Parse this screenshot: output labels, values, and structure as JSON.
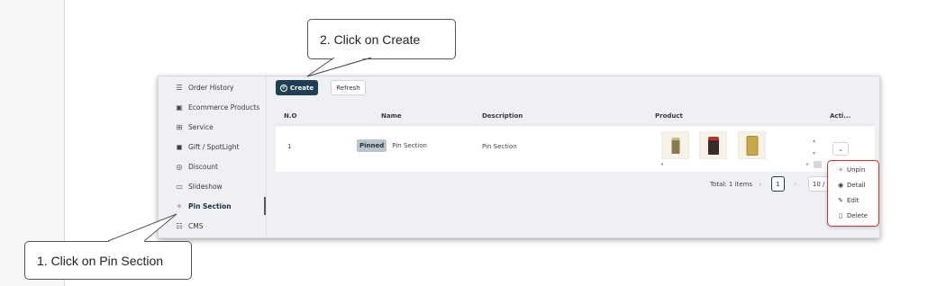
{
  "sidebar": {
    "items": [
      {
        "label": "Order History",
        "icon": "list-icon",
        "glyph": "☰"
      },
      {
        "label": "Ecommerce Products",
        "icon": "box-icon",
        "glyph": "▣"
      },
      {
        "label": "Service",
        "icon": "grid-icon",
        "glyph": "⊞"
      },
      {
        "label": "Gift / SpotLight",
        "icon": "gift-icon",
        "glyph": "◼"
      },
      {
        "label": "Discount",
        "icon": "discount-icon",
        "glyph": "◎"
      },
      {
        "label": "Slideshow",
        "icon": "slideshow-icon",
        "glyph": "▭"
      },
      {
        "label": "Pin Section",
        "icon": "pin-icon",
        "glyph": "✧"
      },
      {
        "label": "CMS",
        "icon": "cms-icon",
        "glyph": "☷"
      }
    ],
    "active": "Pin Section"
  },
  "toolbar": {
    "create_label": "Create",
    "refresh_label": "Refresh"
  },
  "table": {
    "columns": [
      "N.O",
      "Name",
      "Description",
      "Product",
      "Acti..."
    ],
    "rows": [
      {
        "no": "1",
        "badge": "Pinned",
        "name": "Pin Section",
        "description": "Pin Section",
        "product_count": 3
      }
    ]
  },
  "pagination": {
    "total": "Total: 1 items",
    "current_page": "1",
    "page_size": "10 / p"
  },
  "action_menu": {
    "items": [
      {
        "label": "Unpin",
        "icon": "unpin-icon",
        "glyph": "✧"
      },
      {
        "label": "Detail",
        "icon": "eye-icon",
        "glyph": "◉"
      },
      {
        "label": "Edit",
        "icon": "edit-icon",
        "glyph": "✎"
      },
      {
        "label": "Delete",
        "icon": "trash-icon",
        "glyph": "🗑"
      }
    ]
  },
  "annotations": {
    "step1": "1. Click on Pin Section",
    "step2": "2. Click on Create"
  },
  "colors": {
    "primary": "#1f3f52",
    "highlight_border": "#cc3333",
    "badge_bg": "#b9c5cb"
  }
}
